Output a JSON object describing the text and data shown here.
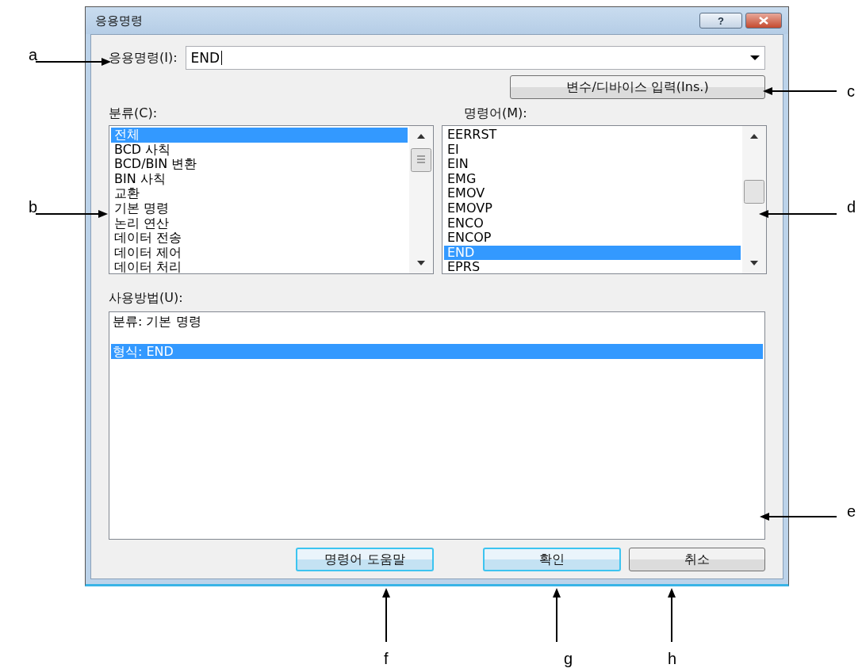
{
  "dialog": {
    "title": "응용명령",
    "help_button": "?",
    "instruction_field": {
      "label": "응용명령(I):",
      "value": "END"
    },
    "variable_button": "변수/디바이스 입력(Ins.)",
    "category": {
      "label": "분류(C):",
      "items": [
        {
          "label": "전체",
          "selected": true
        },
        {
          "label": "BCD 사칙",
          "selected": false
        },
        {
          "label": "BCD/BIN 변환",
          "selected": false
        },
        {
          "label": "BIN 사칙",
          "selected": false
        },
        {
          "label": "교환",
          "selected": false
        },
        {
          "label": "기본 명령",
          "selected": false
        },
        {
          "label": "논리 연산",
          "selected": false
        },
        {
          "label": "데이터 전송",
          "selected": false
        },
        {
          "label": "데이터 제어",
          "selected": false
        },
        {
          "label": "데이터 처리",
          "selected": false
        }
      ]
    },
    "command": {
      "label": "명령어(M):",
      "items": [
        {
          "label": "EERRST",
          "selected": false
        },
        {
          "label": "EI",
          "selected": false
        },
        {
          "label": "EIN",
          "selected": false
        },
        {
          "label": "EMG",
          "selected": false
        },
        {
          "label": "EMOV",
          "selected": false
        },
        {
          "label": "EMOVP",
          "selected": false
        },
        {
          "label": "ENCO",
          "selected": false
        },
        {
          "label": "ENCOP",
          "selected": false
        },
        {
          "label": "END",
          "selected": true
        },
        {
          "label": "EPRS",
          "selected": false
        }
      ]
    },
    "usage": {
      "label": "사용방법(U):",
      "lines": [
        {
          "text": "분류: 기본 명령",
          "selected": false,
          "blank_before": false
        },
        {
          "text": "형식: END",
          "selected": true,
          "blank_before": true
        }
      ]
    },
    "buttons": [
      {
        "label": "명령어 도움말",
        "default": true
      },
      {
        "label": "확인",
        "default": true
      },
      {
        "label": "취소",
        "default": false
      }
    ]
  },
  "callouts": [
    {
      "letter": "a"
    },
    {
      "letter": "b"
    },
    {
      "letter": "c"
    },
    {
      "letter": "d"
    },
    {
      "letter": "e"
    },
    {
      "letter": "f"
    },
    {
      "letter": "g"
    },
    {
      "letter": "h"
    }
  ]
}
